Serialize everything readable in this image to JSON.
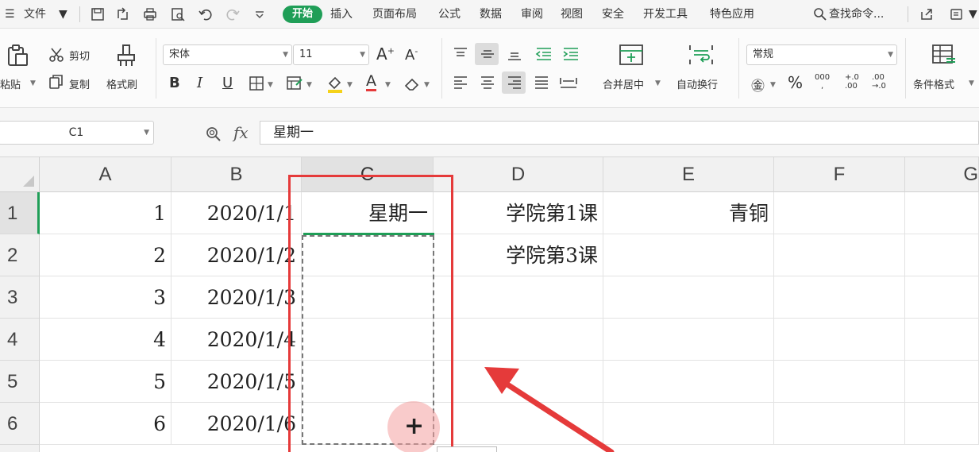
{
  "menubar": {
    "menu_file": "文件",
    "tabs": [
      "开始",
      "插入",
      "页面布局",
      "公式",
      "数据",
      "审阅",
      "视图",
      "安全",
      "开发工具",
      "特色应用"
    ],
    "search": "查找命令..."
  },
  "ribbon": {
    "clipboard": {
      "paste": "粘贴",
      "cut": "剪切",
      "copy": "复制",
      "format_painter": "格式刷"
    },
    "font": {
      "name": "宋体",
      "size": "11"
    },
    "alignment": {
      "merge_center": "合并居中",
      "wrap_text": "自动换行"
    },
    "number": {
      "format": "常规"
    },
    "styles": {
      "conditional_format": "条件格式"
    }
  },
  "formula_bar": {
    "name_box": "C1",
    "fx": "fx",
    "value": "星期一"
  },
  "grid": {
    "columns": [
      "A",
      "B",
      "C",
      "D",
      "E",
      "F",
      "G"
    ],
    "rows": [
      {
        "num": "1",
        "A": "1",
        "B": "2020/1/1",
        "C": "星期一",
        "D": "学院第1课",
        "E": "青铜"
      },
      {
        "num": "2",
        "A": "2",
        "B": "2020/1/2",
        "C": "",
        "D": "学院第3课",
        "E": ""
      },
      {
        "num": "3",
        "A": "3",
        "B": "2020/1/3",
        "C": "",
        "D": "",
        "E": ""
      },
      {
        "num": "4",
        "A": "4",
        "B": "2020/1/4",
        "C": "",
        "D": "",
        "E": ""
      },
      {
        "num": "5",
        "A": "5",
        "B": "2020/1/5",
        "C": "",
        "D": "",
        "E": ""
      },
      {
        "num": "6",
        "A": "6",
        "B": "2020/1/6",
        "C": "",
        "D": "",
        "E": ""
      }
    ]
  },
  "colors": {
    "accent": "#1f9e57",
    "annotation": "#e53a3a"
  }
}
